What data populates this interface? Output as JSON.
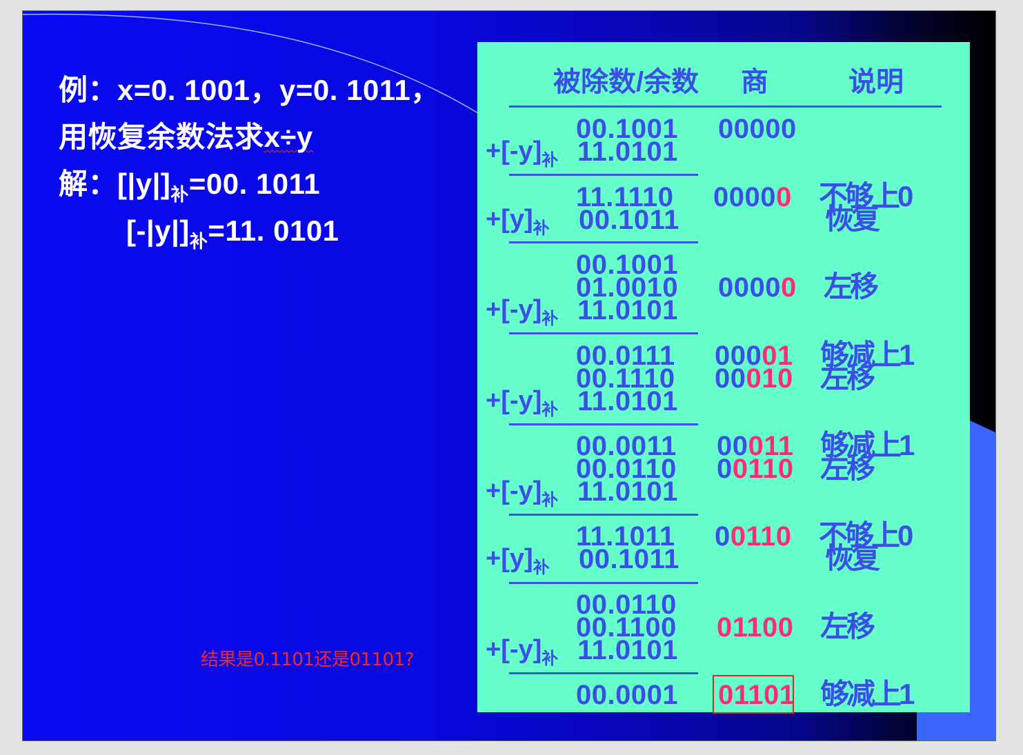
{
  "slide": {
    "title_lines": {
      "example": "例：x=0. 1001，y=0. 1011，",
      "ask_main": "用恢复余数法求",
      "ask_expr": "x÷y",
      "sol1_main": "解：[|y|]",
      "sol1_sub": "补",
      "sol1_val": "=00. 1011",
      "sol2_main": "[-|y|]",
      "sol2_sub": "补",
      "sol2_val": "=11. 0101"
    },
    "note": "结果是0.1101还是01101?"
  },
  "table": {
    "headers": {
      "dividend": "被除数/余数",
      "quotient": "商",
      "remark": "说明"
    },
    "ops": {
      "neg_y_main": "+[-y]",
      "pos_y_main": "+[y]",
      "sub": "补"
    },
    "numbers": [
      "00.1001",
      "11.0101",
      "11.1110",
      "00.1011",
      "00.1001",
      "01.0010",
      "11.0101",
      "00.0111",
      "00.1110",
      "11.0101",
      "00.0011",
      "00.0110",
      "11.0101",
      "11.1011",
      "00.1011",
      "00.0110",
      "00.1100",
      "11.0101",
      "00.0001"
    ],
    "quotients": [
      {
        "plain": "00000",
        "red": ""
      },
      {
        "plain": "0000",
        "red": "0"
      },
      {
        "plain": "0000",
        "red": "0"
      },
      {
        "plain": "000",
        "red": "01"
      },
      {
        "plain": "00",
        "red": "010"
      },
      {
        "plain": "00",
        "red": "011"
      },
      {
        "plain": "0",
        "red": "0110"
      },
      {
        "plain": "0",
        "red": "0110"
      },
      {
        "plain": "",
        "red": "01100"
      },
      {
        "plain": "",
        "red": "01101"
      }
    ],
    "remarks": [
      "不够上0",
      "恢复",
      "左移",
      "够减上1",
      "左移",
      "够减上1",
      "左移",
      "不够上0",
      "恢复",
      "左移",
      "够减上1"
    ]
  }
}
